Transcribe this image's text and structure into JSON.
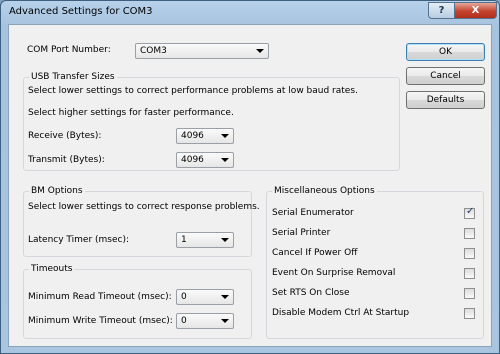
{
  "window": {
    "title": "Advanced Settings for COM3",
    "help": "?",
    "close": "X"
  },
  "com_port": {
    "label": "COM Port Number:",
    "value": "COM3"
  },
  "usb": {
    "legend": "USB Transfer Sizes",
    "note1": "Select lower settings to correct performance problems at low baud rates.",
    "note2": "Select higher settings for faster performance.",
    "receive": {
      "label": "Receive (Bytes):",
      "value": "4096"
    },
    "transmit": {
      "label": "Transmit (Bytes):",
      "value": "4096"
    }
  },
  "bm": {
    "legend": "BM Options",
    "note": "Select lower settings to correct response problems.",
    "latency": {
      "label": "Latency Timer (msec):",
      "value": "1"
    }
  },
  "timeouts": {
    "legend": "Timeouts",
    "read": {
      "label": "Minimum Read Timeout (msec):",
      "value": "0"
    },
    "write": {
      "label": "Minimum Write Timeout (msec):",
      "value": "0"
    }
  },
  "misc": {
    "legend": "Miscellaneous Options",
    "options": [
      {
        "label": "Serial Enumerator",
        "checked": true
      },
      {
        "label": "Serial Printer",
        "checked": false
      },
      {
        "label": "Cancel If Power Off",
        "checked": false
      },
      {
        "label": "Event On Surprise Removal",
        "checked": false
      },
      {
        "label": "Set RTS On Close",
        "checked": false
      },
      {
        "label": "Disable Modem Ctrl At Startup",
        "checked": false
      }
    ]
  },
  "buttons": {
    "ok": "OK",
    "cancel": "Cancel",
    "defaults": "Defaults"
  },
  "check_glyph": "✓"
}
